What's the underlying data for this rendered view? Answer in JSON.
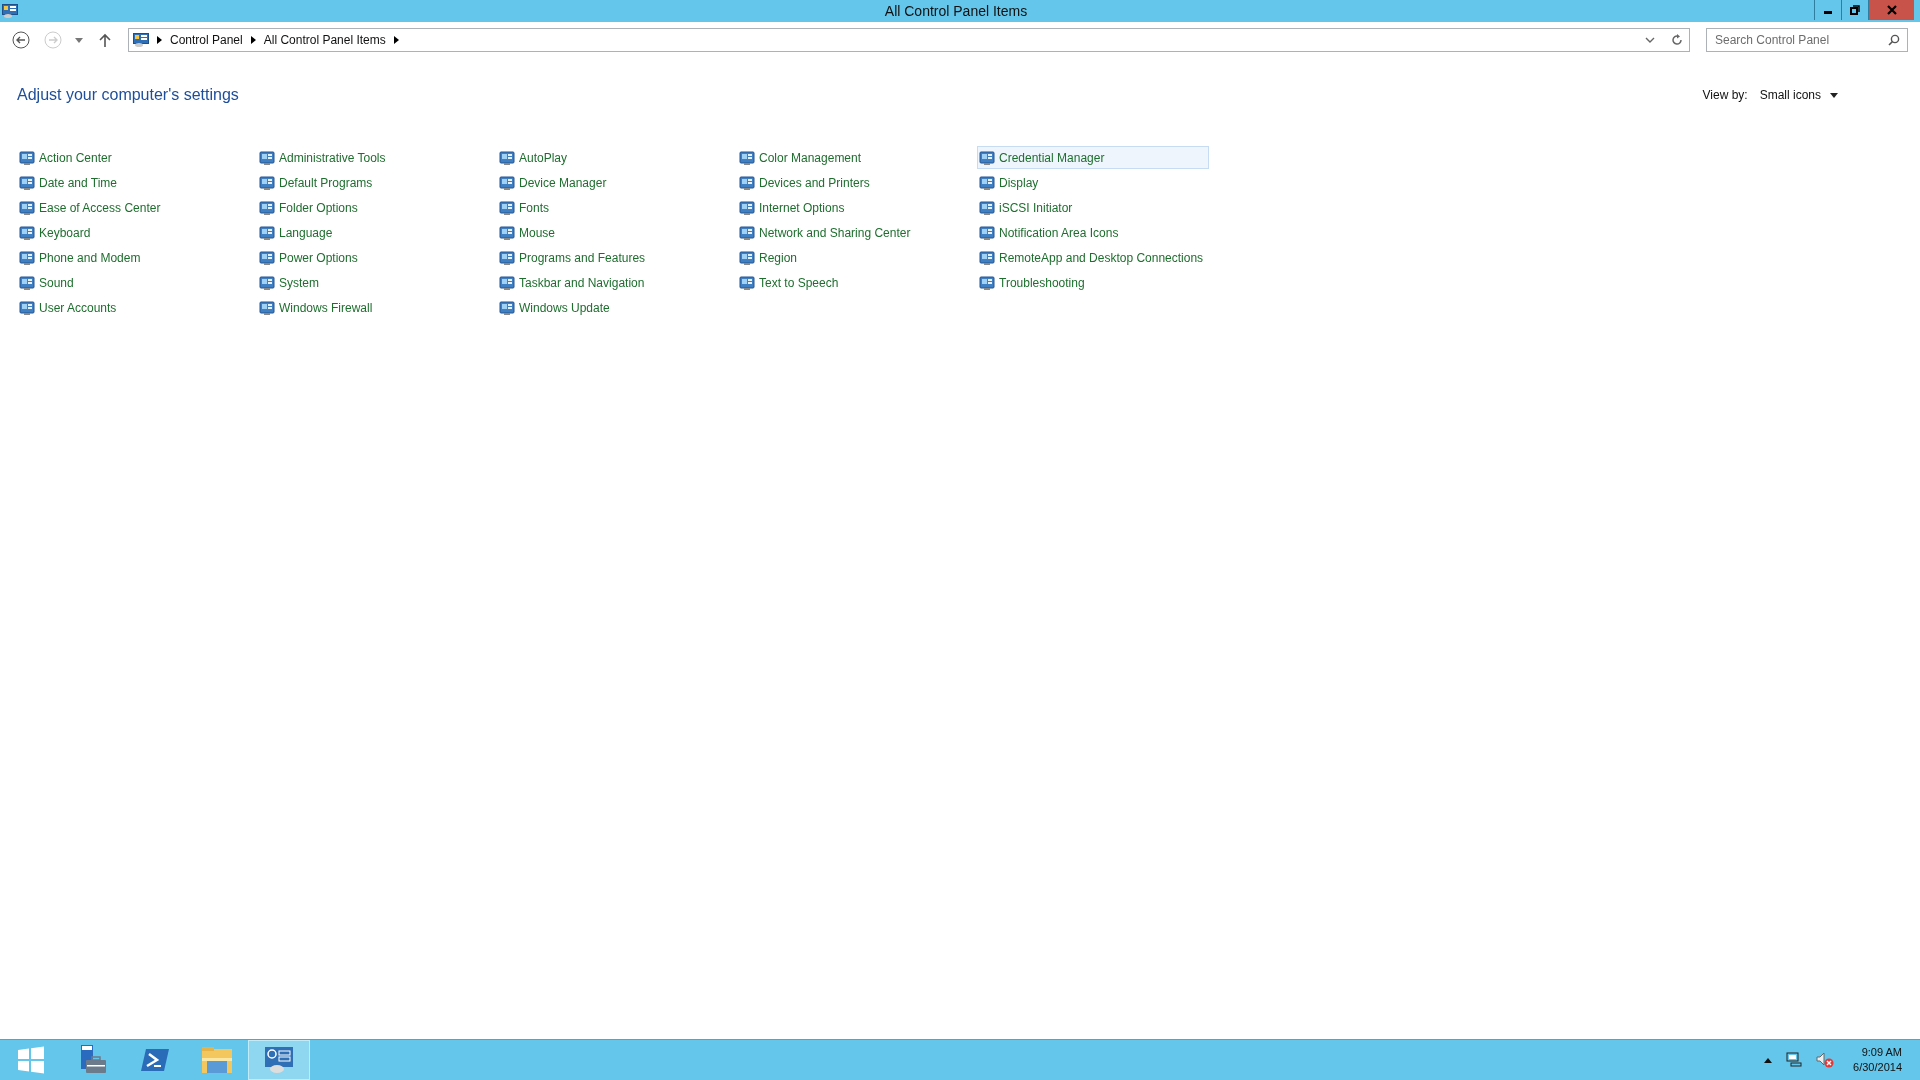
{
  "window": {
    "title": "All Control Panel Items"
  },
  "address_bar": {
    "breadcrumbs": [
      "Control Panel",
      "All Control Panel Items"
    ]
  },
  "search": {
    "placeholder": "Search Control Panel"
  },
  "heading": "Adjust your computer's settings",
  "view_by": {
    "label": "View by:",
    "value": "Small icons"
  },
  "columns": [
    [
      {
        "label": "Action Center",
        "selected": false
      },
      {
        "label": "Date and Time",
        "selected": false
      },
      {
        "label": "Ease of Access Center",
        "selected": false
      },
      {
        "label": "Keyboard",
        "selected": false
      },
      {
        "label": "Phone and Modem",
        "selected": false
      },
      {
        "label": "Sound",
        "selected": false
      },
      {
        "label": "User Accounts",
        "selected": false
      }
    ],
    [
      {
        "label": "Administrative Tools",
        "selected": false
      },
      {
        "label": "Default Programs",
        "selected": false
      },
      {
        "label": "Folder Options",
        "selected": false
      },
      {
        "label": "Language",
        "selected": false
      },
      {
        "label": "Power Options",
        "selected": false
      },
      {
        "label": "System",
        "selected": false
      },
      {
        "label": "Windows Firewall",
        "selected": false
      }
    ],
    [
      {
        "label": "AutoPlay",
        "selected": false
      },
      {
        "label": "Device Manager",
        "selected": false
      },
      {
        "label": "Fonts",
        "selected": false
      },
      {
        "label": "Mouse",
        "selected": false
      },
      {
        "label": "Programs and Features",
        "selected": false
      },
      {
        "label": "Taskbar and Navigation",
        "selected": false
      },
      {
        "label": "Windows Update",
        "selected": false
      }
    ],
    [
      {
        "label": "Color Management",
        "selected": false
      },
      {
        "label": "Devices and Printers",
        "selected": false
      },
      {
        "label": "Internet Options",
        "selected": false
      },
      {
        "label": "Network and Sharing Center",
        "selected": false
      },
      {
        "label": "Region",
        "selected": false
      },
      {
        "label": "Text to Speech",
        "selected": false
      }
    ],
    [
      {
        "label": "Credential Manager",
        "selected": true
      },
      {
        "label": "Display",
        "selected": false
      },
      {
        "label": "iSCSI Initiator",
        "selected": false
      },
      {
        "label": "Notification Area Icons",
        "selected": false
      },
      {
        "label": "RemoteApp and Desktop Connections",
        "selected": false
      },
      {
        "label": "Troubleshooting",
        "selected": false
      }
    ]
  ],
  "taskbar": {
    "clock": {
      "time": "9:09 AM",
      "date": "6/30/2014"
    }
  }
}
